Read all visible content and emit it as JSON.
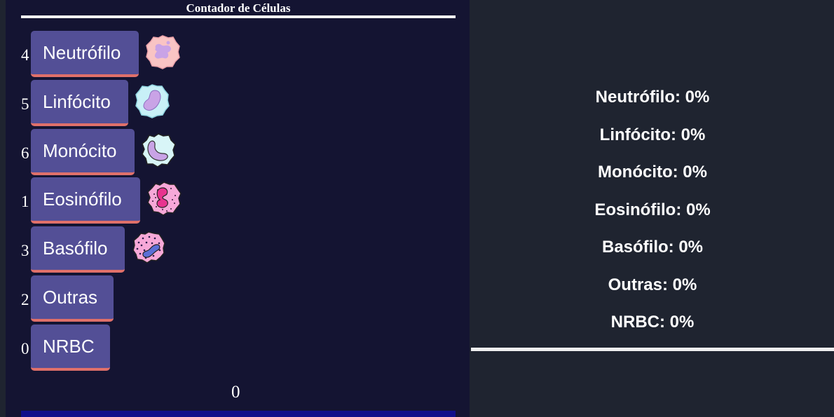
{
  "app": {
    "title": "Contador de Células"
  },
  "cells": [
    {
      "key": "4",
      "label": "Neutrófilo",
      "icon": "neutrophil-icon"
    },
    {
      "key": "5",
      "label": "Linfócito",
      "icon": "lymphocyte-icon"
    },
    {
      "key": "6",
      "label": "Monócito",
      "icon": "monocyte-icon"
    },
    {
      "key": "1",
      "label": "Eosinófilo",
      "icon": "eosinophil-icon"
    },
    {
      "key": "3",
      "label": "Basófilo",
      "icon": "basophil-icon"
    },
    {
      "key": "2",
      "label": "Outras",
      "icon": ""
    },
    {
      "key": "0",
      "label": "NRBC",
      "icon": ""
    }
  ],
  "total": "0",
  "results": [
    "Neutrófilo: 0%",
    "Linfócito: 0%",
    "Monócito: 0%",
    "Eosinófilo: 0%",
    "Basófilo: 0%",
    "Outras: 0%",
    "NRBC: 0%"
  ],
  "colors": {
    "panel_bg": "#141432",
    "page_bg": "#1f2430",
    "button_bg": "#534f96",
    "button_border": "#e0706a",
    "bottom_bar": "#100f8a"
  }
}
